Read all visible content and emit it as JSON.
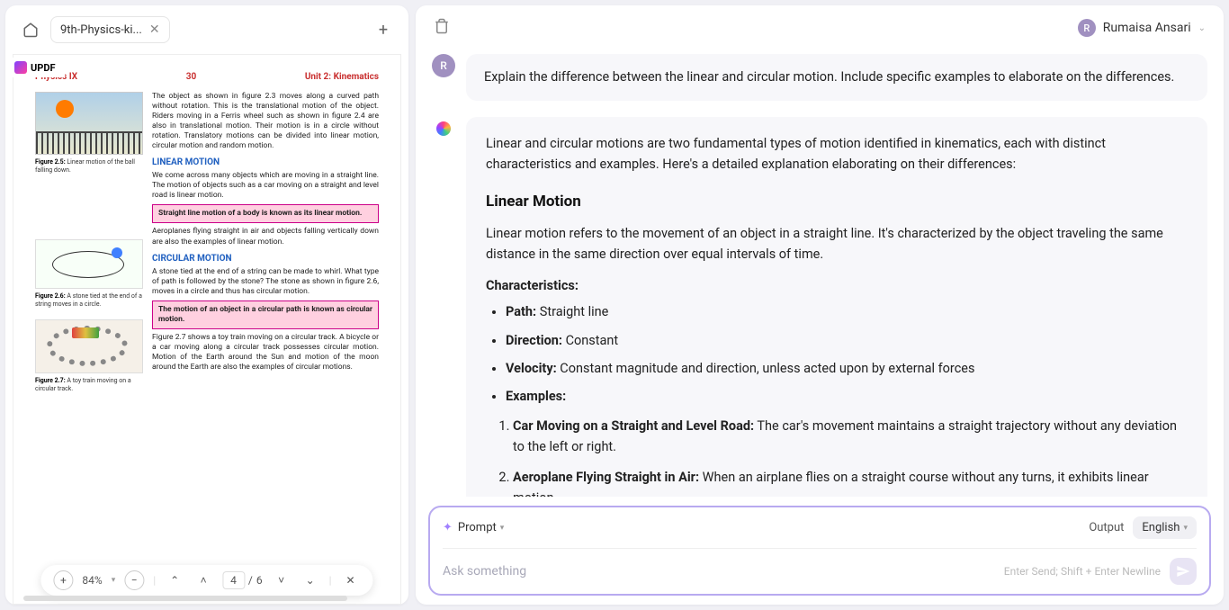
{
  "tab": {
    "title": "9th-Physics-ki..."
  },
  "updf": {
    "label": "UPDF"
  },
  "pdf": {
    "hdr_left": "Physics IX",
    "hdr_mid": "30",
    "hdr_right": "Unit 2: Kinematics",
    "para1": "The object as shown in figure 2.3 moves along a curved path without rotation. This is the translational motion of the object. Riders moving in a Ferris wheel such as shown in figure 2.4 are also in translational motion. Their motion is in a circle without rotation. Translatory motions can be divided into linear motion, circular motion and random motion.",
    "cap1_b": "Figure 2.5:",
    "cap1": " Linear motion of the ball falling down.",
    "linear_title": "LINEAR MOTION",
    "linear_intro": "We come across many objects which are moving in a straight line. The motion of objects such as a car moving on a straight and level road is linear motion.",
    "linear_box": "Straight line motion of a body is known as its linear motion.",
    "linear_ex": "Aeroplanes flying straight in air and objects falling vertically down are also the examples of linear motion.",
    "circular_title": "CIRCULAR MOTION",
    "cap2_b": "Figure 2.6:",
    "cap2": " A stone tied at the end of a string moves in a circle.",
    "circular_intro": "A stone tied at the end of a string can be made to whirl. What type of path is followed by the stone? The stone as shown in figure 2.6, moves in a circle and thus has circular motion.",
    "circular_box": "The motion of an object in a circular path is known as circular motion.",
    "cap3_b": "Figure 2.7:",
    "cap3": " A toy train moving on a circular track.",
    "circular_para": "Figure 2.7 shows a toy train moving on a circular track. A bicycle or a car moving along a circular track possesses circular motion. Motion of the Earth around the Sun and motion of the moon around the Earth are also the examples of circular motions."
  },
  "toolbar": {
    "zoom": "84%",
    "page_current": "4",
    "page_total": "6"
  },
  "user": {
    "name": "Rumaisa Ansari",
    "initial": "R"
  },
  "chat": {
    "user_msg": "Explain the difference between the linear and circular motion. Include specific examples to elaborate on the differences.",
    "intro": "Linear and circular motions are two fundamental types of motion identified in kinematics, each with distinct characteristics and examples. Here's a detailed explanation elaborating on their differences:",
    "h1": "Linear Motion",
    "p1": "Linear motion refers to the movement of an object in a straight line. It's characterized by the object traveling the same distance in the same direction over equal intervals of time.",
    "char_label": "Characteristics:",
    "path_b": "Path:",
    "path_v": " Straight line",
    "dir_b": "Direction:",
    "dir_v": " Constant",
    "vel_b": "Velocity:",
    "vel_v": " Constant magnitude and direction, unless acted upon by external forces",
    "ex_label": "Examples:",
    "ex1_b": "Car Moving on a Straight and Level Road:",
    "ex1_v": " The car's movement maintains a straight trajectory without any deviation to the left or right.",
    "ex2_b": "Aeroplane Flying Straight in Air:",
    "ex2_v": " When an airplane flies on a straight course without any turns, it exhibits linear motion"
  },
  "input": {
    "prompt_label": "Prompt",
    "output_label": "Output",
    "lang": "English",
    "placeholder": "Ask something",
    "hint": "Enter Send; Shift + Enter Newline"
  }
}
